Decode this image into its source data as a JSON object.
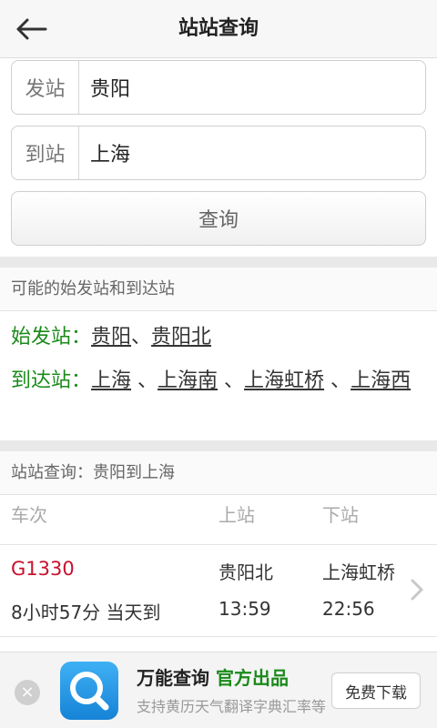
{
  "header": {
    "title": "站站查询",
    "back_icon": "arrow-left-icon"
  },
  "form": {
    "from_label": "发站",
    "from_value": "贵阳",
    "to_label": "到站",
    "to_value": "上海",
    "query_label": "查询"
  },
  "possible": {
    "title": "可能的始发站和到达站",
    "origin_label": "始发站：",
    "origin_stations": [
      "贵阳",
      "贵阳北"
    ],
    "dest_label": "到达站：",
    "dest_stations": [
      "上海",
      "上海南",
      "上海虹桥",
      "上海西"
    ]
  },
  "results": {
    "title": "站站查询：贵阳到上海",
    "columns": {
      "train": "车次",
      "board": "上站",
      "alight": "下站"
    },
    "trains": [
      {
        "number": "G1330",
        "duration": "8小时57分 当天到",
        "from_station": "贵阳北",
        "from_time": "13:59",
        "to_station": "上海虹桥",
        "to_time": "22:56"
      }
    ]
  },
  "ad": {
    "title": "万能查询",
    "tag": "官方出品",
    "subtitle": "支持黄历天气翻译字典汇率等",
    "button": "免费下载",
    "close": "×"
  },
  "colors": {
    "accent_green": "#1a8a1a",
    "train_red": "#c8102e",
    "ad_icon_blue": "#1683d6"
  }
}
